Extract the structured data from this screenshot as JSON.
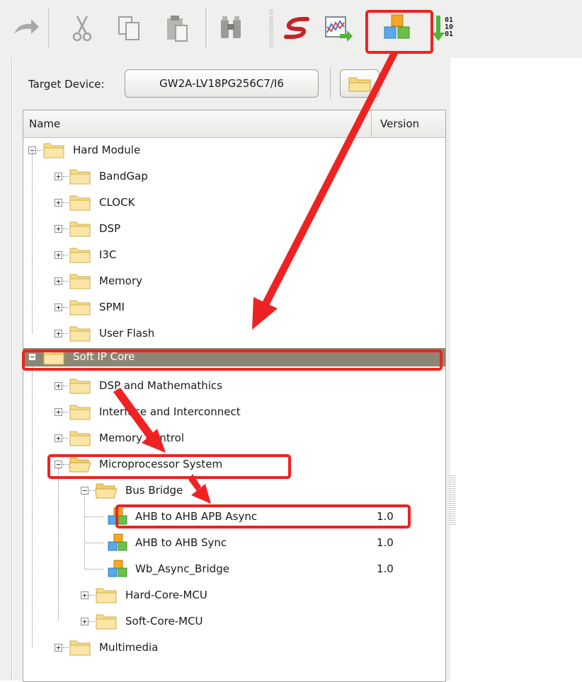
{
  "toolbar": {
    "buttons": [
      {
        "name": "redo-icon"
      },
      {
        "name": "cut-icon"
      },
      {
        "name": "copy-icon"
      },
      {
        "name": "paste-icon"
      },
      {
        "name": "find-icon"
      },
      {
        "name": "synplify-icon"
      },
      {
        "name": "timing-icon"
      },
      {
        "name": "ip-core-generator-icon"
      },
      {
        "name": "program-device-icon"
      }
    ]
  },
  "device": {
    "label": "Target Device:",
    "value": "GW2A-LV18PG256C7/I6"
  },
  "tree": {
    "columns": [
      "Name",
      "Version"
    ],
    "rows": [
      {
        "label": "Hard Module",
        "version": "",
        "level": 0,
        "expanded": true,
        "type": "folder"
      },
      {
        "label": "BandGap",
        "version": "",
        "level": 1,
        "expanded": false,
        "type": "folder"
      },
      {
        "label": "CLOCK",
        "version": "",
        "level": 1,
        "expanded": false,
        "type": "folder"
      },
      {
        "label": "DSP",
        "version": "",
        "level": 1,
        "expanded": false,
        "type": "folder"
      },
      {
        "label": "I3C",
        "version": "",
        "level": 1,
        "expanded": false,
        "type": "folder"
      },
      {
        "label": "Memory",
        "version": "",
        "level": 1,
        "expanded": false,
        "type": "folder"
      },
      {
        "label": "SPMI",
        "version": "",
        "level": 1,
        "expanded": false,
        "type": "folder"
      },
      {
        "label": "User Flash",
        "version": "",
        "level": 1,
        "expanded": false,
        "type": "folder"
      },
      {
        "label": "Soft IP Core",
        "version": "",
        "level": 0,
        "expanded": true,
        "type": "folder",
        "selected": true
      },
      {
        "label": "DSP and Mathemathics",
        "version": "",
        "level": 1,
        "expanded": false,
        "type": "folder"
      },
      {
        "label": "Interface and Interconnect",
        "version": "",
        "level": 1,
        "expanded": false,
        "type": "folder"
      },
      {
        "label": "Memory Control",
        "version": "",
        "level": 1,
        "expanded": false,
        "type": "folder"
      },
      {
        "label": "Microprocessor System",
        "version": "",
        "level": 1,
        "expanded": true,
        "type": "folder-open"
      },
      {
        "label": "Bus Bridge",
        "version": "",
        "level": 2,
        "expanded": true,
        "type": "folder-open"
      },
      {
        "label": "AHB to AHB APB Async",
        "version": "1.0",
        "level": 3,
        "type": "ip"
      },
      {
        "label": "AHB to AHB Sync",
        "version": "1.0",
        "level": 3,
        "type": "ip"
      },
      {
        "label": "Wb_Async_Bridge",
        "version": "1.0",
        "level": 3,
        "type": "ip"
      },
      {
        "label": "Hard-Core-MCU",
        "version": "",
        "level": 2,
        "expanded": false,
        "type": "folder"
      },
      {
        "label": "Soft-Core-MCU",
        "version": "",
        "level": 2,
        "expanded": false,
        "type": "folder"
      },
      {
        "label": "Multimedia",
        "version": "",
        "level": 1,
        "expanded": false,
        "type": "folder"
      }
    ]
  },
  "annotation_color": "#ee2222"
}
